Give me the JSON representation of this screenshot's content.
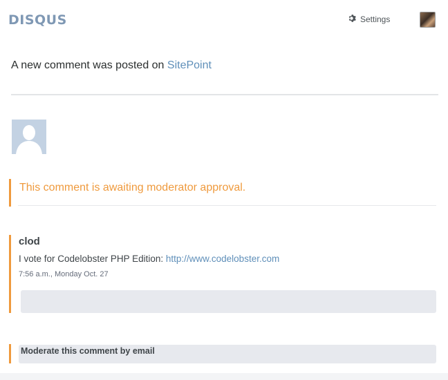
{
  "header": {
    "logo": "DISQUS",
    "settings_label": "Settings",
    "settings_icon": "gear-icon",
    "avatar_icon": "user-avatar-icon"
  },
  "headline": {
    "prefix": "A new comment was posted on ",
    "site_name": "SitePoint"
  },
  "notice": {
    "text": "This comment is awaiting moderator approval."
  },
  "comment": {
    "author": "clod",
    "body_prefix": "I vote for Codelobster PHP Edition: ",
    "link": "http://www.codelobster.com",
    "timestamp": "7:56 a.m., Monday Oct. 27"
  },
  "moderate": {
    "label": "Moderate this comment by email"
  },
  "colors": {
    "brand": "#7f98b4",
    "link": "#5f8fb9",
    "pending": "#ef9a3d",
    "bar": "#e7e9ee"
  }
}
